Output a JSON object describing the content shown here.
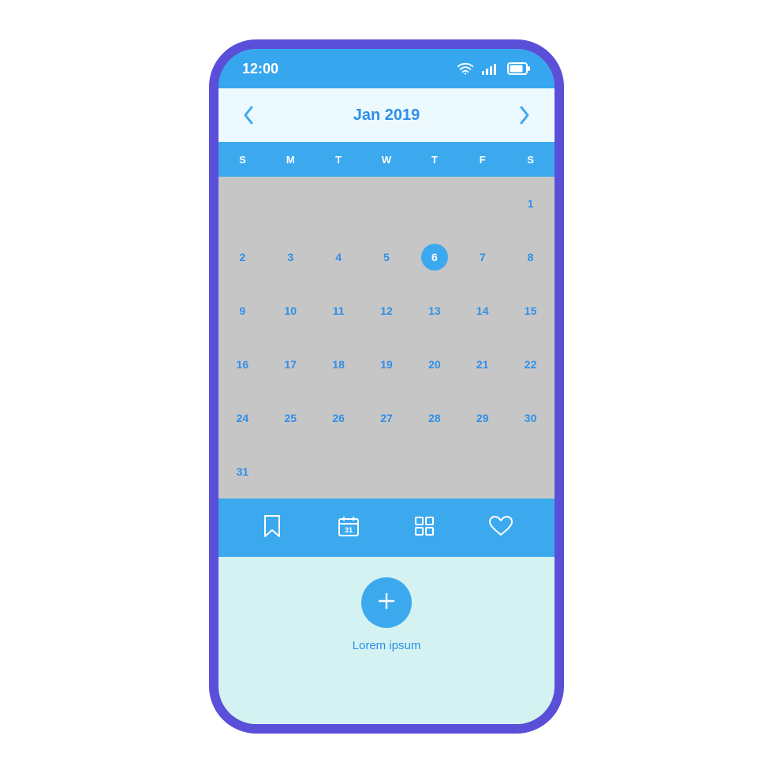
{
  "colors": {
    "frame": "#5a4fd8",
    "primary": "#3ca9ef",
    "accent_text": "#2f8fe8",
    "grid_bg": "#c6c6c6",
    "pale_bg": "#d3f2f1",
    "header_pale": "#ecfaff"
  },
  "status_bar": {
    "time": "12:00"
  },
  "month_nav": {
    "label": "Jan 2019"
  },
  "weekdays": [
    "S",
    "M",
    "T",
    "W",
    "T",
    "F",
    "S"
  ],
  "calendar": {
    "month": "January",
    "year": 2019,
    "selected_day": 6,
    "weeks": [
      [
        null,
        null,
        null,
        null,
        null,
        null,
        1
      ],
      [
        2,
        3,
        4,
        5,
        6,
        7,
        8
      ],
      [
        9,
        10,
        11,
        12,
        13,
        14,
        15
      ],
      [
        16,
        17,
        18,
        19,
        20,
        21,
        22
      ],
      [
        24,
        25,
        26,
        27,
        28,
        29,
        30
      ],
      [
        31,
        null,
        null,
        null,
        null,
        null,
        null
      ]
    ]
  },
  "bottom_nav": {
    "items": [
      {
        "icon": "bookmark-icon"
      },
      {
        "icon": "calendar-icon"
      },
      {
        "icon": "grid-icon"
      },
      {
        "icon": "heart-icon"
      }
    ]
  },
  "fab": {
    "label": "Lorem ipsum"
  }
}
